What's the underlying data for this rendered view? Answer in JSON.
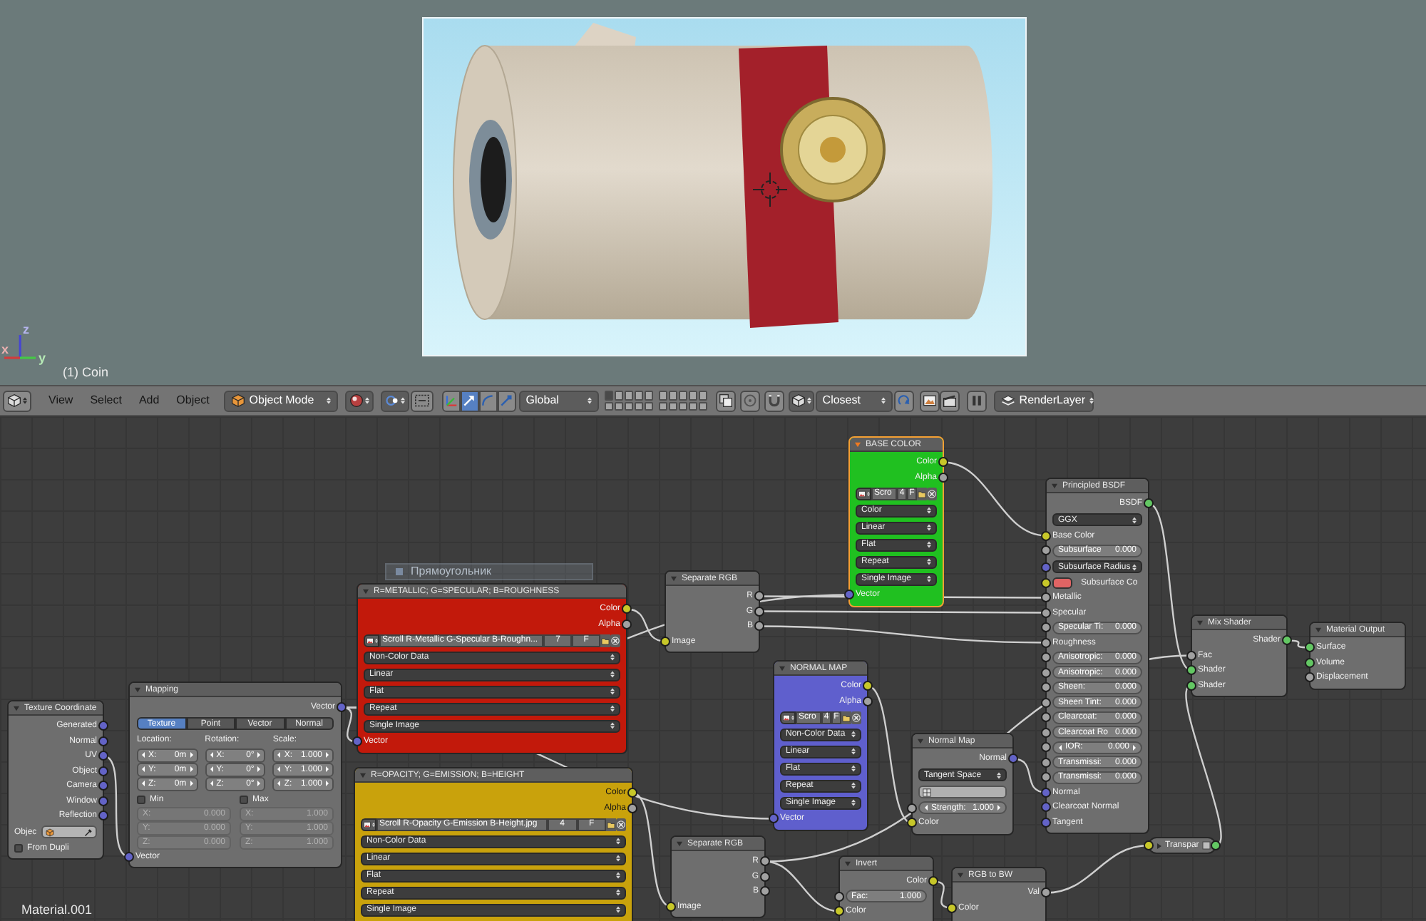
{
  "viewport": {
    "axes": [
      {
        "label": "z",
        "color": "#4646d2"
      },
      {
        "label": "x",
        "color": "#d23c3c"
      },
      {
        "label": "y",
        "color": "#46c846"
      }
    ],
    "object_label": "(1) Coin"
  },
  "header": {
    "menus": [
      "View",
      "Select",
      "Add",
      "Object"
    ],
    "mode": "Object Mode",
    "manipulators": [
      {
        "kind": "axes",
        "selected": false
      },
      {
        "kind": "translate",
        "selected": true
      },
      {
        "kind": "rotate",
        "selected": false
      },
      {
        "kind": "scale",
        "selected": false
      }
    ],
    "orientation": "Global",
    "layers": [
      {
        "selected": true
      },
      {
        "selected": false
      },
      {
        "selected": false
      },
      {
        "selected": false
      },
      {
        "selected": false
      },
      {
        "selected": false
      },
      {
        "selected": false
      },
      {
        "selected": false
      },
      {
        "selected": false
      },
      {
        "selected": false
      },
      {
        "selected": false
      },
      {
        "selected": false
      },
      {
        "selected": false
      },
      {
        "selected": false
      },
      {
        "selected": false
      },
      {
        "selected": false
      },
      {
        "selected": false
      },
      {
        "selected": false
      },
      {
        "selected": false
      },
      {
        "selected": false
      }
    ],
    "snap_target": "Closest",
    "render_layer": "RenderLayer"
  },
  "overlay_label": "Прямоугольник",
  "nodes": [
    {
      "title": "Texture Coordinate",
      "collapsed": false,
      "selected": false,
      "rows": [
        {
          "kind": "output",
          "label": "Generated",
          "socket": {
            "kind": "vector"
          }
        },
        {
          "kind": "output",
          "label": "Normal",
          "socket": {
            "kind": "vector"
          }
        },
        {
          "kind": "output",
          "label": "UV",
          "socket": {
            "kind": "vector"
          }
        },
        {
          "kind": "output",
          "label": "Object",
          "socket": {
            "kind": "vector"
          }
        },
        {
          "kind": "output",
          "label": "Camera",
          "socket": {
            "kind": "vector"
          }
        },
        {
          "kind": "output",
          "label": "Window",
          "socket": {
            "kind": "vector"
          }
        },
        {
          "kind": "output",
          "label": "Reflection",
          "socket": {
            "kind": "vector"
          }
        },
        {
          "kind": "object_field",
          "label": "Objec"
        },
        {
          "kind": "checkbox",
          "label": "From Dupli",
          "checked": false
        }
      ]
    },
    {
      "title": "Mapping",
      "collapsed": false,
      "selected": false,
      "rows": [
        {
          "kind": "output",
          "label": "Vector",
          "socket": {
            "kind": "vector"
          }
        },
        {
          "kind": "tabs",
          "items": [
            {
              "label": "Texture",
              "selected": true
            },
            {
              "label": "Point",
              "selected": false
            },
            {
              "label": "Vector",
              "selected": false
            },
            {
              "label": "Normal",
              "selected": false
            }
          ]
        },
        {
          "kind": "vector_columns",
          "columns": [
            {
              "label": "Location:",
              "fields": [
                {
                  "label": "X:",
                  "value": "0m"
                },
                {
                  "label": "Y:",
                  "value": "0m"
                },
                {
                  "label": "Z:",
                  "value": "0m"
                }
              ]
            },
            {
              "label": "Rotation:",
              "fields": [
                {
                  "label": "X:",
                  "value": "0°"
                },
                {
                  "label": "Y:",
                  "value": "0°"
                },
                {
                  "label": "Z:",
                  "value": "0°"
                }
              ]
            },
            {
              "label": "Scale:",
              "fields": [
                {
                  "label": "X:",
                  "value": "1.000"
                },
                {
                  "label": "Y:",
                  "value": "1.000"
                },
                {
                  "label": "Z:",
                  "value": "1.000"
                }
              ]
            }
          ]
        },
        {
          "kind": "limit_columns",
          "columns": [
            {
              "label": "Min",
              "checked": false,
              "fields": [
                {
                  "label": "X:",
                  "value": "0.000"
                },
                {
                  "label": "Y:",
                  "value": "0.000"
                },
                {
                  "label": "Z:",
                  "value": "0.000"
                }
              ]
            },
            {
              "label": "Max",
              "checked": false,
              "fields": [
                {
                  "label": "X:",
                  "value": "1.000"
                },
                {
                  "label": "Y:",
                  "value": "1.000"
                },
                {
                  "label": "Z:",
                  "value": "1.000"
                }
              ]
            }
          ]
        },
        {
          "kind": "input",
          "label": "Vector",
          "socket": {
            "kind": "vector"
          }
        }
      ]
    },
    {
      "title": "R=METALLIC; G=SPECULAR; B=ROUGHNESS",
      "color": "#c2190b",
      "collapsed": false,
      "selected": false,
      "rows": [
        {
          "kind": "output",
          "label": "Color",
          "socket": {
            "kind": "color"
          }
        },
        {
          "kind": "output",
          "label": "Alpha",
          "socket": {
            "kind": "value"
          }
        },
        {
          "kind": "image",
          "name": "Scroll R-Metallic G-Specular B-Roughn...",
          "users": "7",
          "fake_user": "F"
        },
        {
          "kind": "dropdown",
          "value": "Non-Color Data"
        },
        {
          "kind": "dropdown",
          "value": "Linear"
        },
        {
          "kind": "dropdown",
          "value": "Flat"
        },
        {
          "kind": "dropdown",
          "value": "Repeat"
        },
        {
          "kind": "dropdown",
          "value": "Single Image"
        },
        {
          "kind": "input",
          "label": "Vector",
          "socket": {
            "kind": "vector"
          }
        }
      ]
    },
    {
      "title": "R=OPACITY; G=EMISSION; B=HEIGHT",
      "color": "#c9a20c",
      "collapsed": false,
      "selected": false,
      "rows": [
        {
          "kind": "output",
          "label": "Color",
          "socket": {
            "kind": "color"
          }
        },
        {
          "kind": "output",
          "label": "Alpha",
          "socket": {
            "kind": "value"
          }
        },
        {
          "kind": "image",
          "name": "Scroll R-Opacity G-Emission B-Height.jpg",
          "users": "4",
          "fake_user": "F"
        },
        {
          "kind": "dropdown",
          "value": "Non-Color Data"
        },
        {
          "kind": "dropdown",
          "value": "Linear"
        },
        {
          "kind": "dropdown",
          "value": "Flat"
        },
        {
          "kind": "dropdown",
          "value": "Repeat"
        },
        {
          "kind": "dropdown",
          "value": "Single Image"
        }
      ]
    },
    {
      "title": "Separate RGB",
      "collapsed": false,
      "selected": false,
      "rows": [
        {
          "kind": "output",
          "label": "R",
          "socket": {
            "kind": "value"
          }
        },
        {
          "kind": "output",
          "label": "G",
          "socket": {
            "kind": "value"
          }
        },
        {
          "kind": "output",
          "label": "B",
          "socket": {
            "kind": "value"
          }
        },
        {
          "kind": "input",
          "label": "Image",
          "socket": {
            "kind": "color"
          }
        }
      ]
    },
    {
      "title": "BASE COLOR",
      "color": "#20c020",
      "collapsed": false,
      "selected": true,
      "rows": [
        {
          "kind": "output",
          "label": "Color",
          "socket": {
            "kind": "color"
          }
        },
        {
          "kind": "output",
          "label": "Alpha",
          "socket": {
            "kind": "value"
          }
        },
        {
          "kind": "image",
          "name": "Scro",
          "users": "4",
          "fake_user": "F"
        },
        {
          "kind": "dropdown",
          "value": "Color"
        },
        {
          "kind": "dropdown",
          "value": "Linear"
        },
        {
          "kind": "dropdown",
          "value": "Flat"
        },
        {
          "kind": "dropdown",
          "value": "Repeat"
        },
        {
          "kind": "dropdown",
          "value": "Single Image"
        },
        {
          "kind": "input",
          "label": "Vector",
          "socket": {
            "kind": "vector"
          }
        }
      ]
    },
    {
      "title": "NORMAL MAP",
      "color": "#5f5fcd",
      "collapsed": false,
      "selected": false,
      "rows": [
        {
          "kind": "output",
          "label": "Color",
          "socket": {
            "kind": "color"
          }
        },
        {
          "kind": "output",
          "label": "Alpha",
          "socket": {
            "kind": "value"
          }
        },
        {
          "kind": "image",
          "name": "Scro",
          "users": "4",
          "fake_user": "F"
        },
        {
          "kind": "dropdown",
          "value": "Non-Color Data"
        },
        {
          "kind": "dropdown",
          "value": "Linear"
        },
        {
          "kind": "dropdown",
          "value": "Flat"
        },
        {
          "kind": "dropdown",
          "value": "Repeat"
        },
        {
          "kind": "dropdown",
          "value": "Single Image"
        },
        {
          "kind": "input",
          "label": "Vector",
          "socket": {
            "kind": "vector"
          }
        }
      ]
    },
    {
      "title": "Normal Map",
      "collapsed": false,
      "selected": false,
      "rows": [
        {
          "kind": "output",
          "label": "Normal",
          "socket": {
            "kind": "vector"
          }
        },
        {
          "kind": "dropdown",
          "value": "Tangent Space"
        },
        {
          "kind": "search_field"
        },
        {
          "kind": "number",
          "label": "Strength:",
          "value": "1.000",
          "socket": {
            "kind": "value"
          }
        },
        {
          "kind": "input",
          "label": "Color",
          "socket": {
            "kind": "color"
          }
        }
      ]
    },
    {
      "title": "Separate RGB",
      "collapsed": false,
      "selected": false,
      "rows": [
        {
          "kind": "output",
          "label": "R",
          "socket": {
            "kind": "value"
          }
        },
        {
          "kind": "output",
          "label": "G",
          "socket": {
            "kind": "value"
          }
        },
        {
          "kind": "output",
          "label": "B",
          "socket": {
            "kind": "value"
          }
        },
        {
          "kind": "input",
          "label": "Image",
          "socket": {
            "kind": "color"
          }
        }
      ]
    },
    {
      "title": "Invert",
      "collapsed": false,
      "selected": false,
      "rows": [
        {
          "kind": "output",
          "label": "Color",
          "socket": {
            "kind": "color"
          }
        },
        {
          "kind": "slider",
          "label": "Fac:",
          "value": "1.000",
          "socket": {
            "kind": "value"
          }
        },
        {
          "kind": "input",
          "label": "Color",
          "socket": {
            "kind": "color"
          }
        }
      ]
    },
    {
      "title": "RGB to BW",
      "collapsed": false,
      "selected": false,
      "rows": [
        {
          "kind": "output",
          "label": "Val",
          "socket": {
            "kind": "value"
          }
        },
        {
          "kind": "input",
          "label": "Color",
          "socket": {
            "kind": "color"
          }
        }
      ]
    },
    {
      "title": "Principled BSDF",
      "collapsed": false,
      "selected": false,
      "rows": [
        {
          "kind": "output",
          "label": "BSDF",
          "socket": {
            "kind": "shader"
          }
        },
        {
          "kind": "dropdown",
          "value": "GGX"
        },
        {
          "kind": "input",
          "label": "Base Color",
          "socket": {
            "kind": "color"
          }
        },
        {
          "kind": "slider",
          "label": "Subsurface",
          "value": "0.000",
          "socket": {
            "kind": "value"
          }
        },
        {
          "kind": "dropdown",
          "value": "Subsurface Radius",
          "socket": {
            "kind": "vector"
          }
        },
        {
          "kind": "color_input",
          "label": "Subsurface Co",
          "color": "#e06464",
          "socket": {
            "kind": "color"
          }
        },
        {
          "kind": "input",
          "label": "Metallic",
          "socket": {
            "kind": "value"
          }
        },
        {
          "kind": "input",
          "label": "Specular",
          "socket": {
            "kind": "value"
          }
        },
        {
          "kind": "slider",
          "label": "Specular Ti:",
          "value": "0.000",
          "socket": {
            "kind": "value"
          }
        },
        {
          "kind": "input",
          "label": "Roughness",
          "socket": {
            "kind": "value"
          }
        },
        {
          "kind": "slider",
          "label": "Anisotropic:",
          "value": "0.000",
          "socket": {
            "kind": "value"
          }
        },
        {
          "kind": "slider",
          "label": "Anisotropic:",
          "value": "0.000",
          "socket": {
            "kind": "value"
          }
        },
        {
          "kind": "slider",
          "label": "Sheen:",
          "value": "0.000",
          "socket": {
            "kind": "value"
          }
        },
        {
          "kind": "slider",
          "label": "Sheen Tint:",
          "value": "0.000",
          "socket": {
            "kind": "value"
          }
        },
        {
          "kind": "slider",
          "label": "Clearcoat:",
          "value": "0.000",
          "socket": {
            "kind": "value"
          }
        },
        {
          "kind": "slider",
          "label": "Clearcoat Ro",
          "value": "0.000",
          "socket": {
            "kind": "value"
          }
        },
        {
          "kind": "number",
          "label": "IOR:",
          "value": "0.000",
          "socket": {
            "kind": "value"
          }
        },
        {
          "kind": "slider",
          "label": "Transmissi:",
          "value": "0.000",
          "socket": {
            "kind": "value"
          }
        },
        {
          "kind": "slider",
          "label": "Transmissi:",
          "value": "0.000",
          "socket": {
            "kind": "value"
          }
        },
        {
          "kind": "input",
          "label": "Normal",
          "socket": {
            "kind": "vector"
          }
        },
        {
          "kind": "input",
          "label": "Clearcoat Normal",
          "socket": {
            "kind": "vector"
          }
        },
        {
          "kind": "input",
          "label": "Tangent",
          "socket": {
            "kind": "vector"
          }
        }
      ]
    },
    {
      "title": "Mix Shader",
      "collapsed": false,
      "selected": false,
      "rows": [
        {
          "kind": "output",
          "label": "Shader",
          "socket": {
            "kind": "shader"
          }
        },
        {
          "kind": "input",
          "label": "Fac",
          "socket": {
            "kind": "value"
          }
        },
        {
          "kind": "input",
          "label": "Shader",
          "socket": {
            "kind": "shader"
          }
        },
        {
          "kind": "input",
          "label": "Shader",
          "socket": {
            "kind": "shader"
          }
        }
      ]
    },
    {
      "title": "Material Output",
      "collapsed": false,
      "selected": false,
      "rows": [
        {
          "kind": "input",
          "label": "Surface",
          "socket": {
            "kind": "shader"
          }
        },
        {
          "kind": "input",
          "label": "Volume",
          "socket": {
            "kind": "shader"
          }
        },
        {
          "kind": "input",
          "label": "Displacement",
          "socket": {
            "kind": "value"
          }
        }
      ]
    },
    {
      "title": "Transpar",
      "collapsed": true,
      "selected": false,
      "rows": [
        {
          "kind": "input",
          "socket": {
            "kind": "color"
          }
        },
        {
          "kind": "output",
          "socket": {
            "kind": "shader"
          }
        }
      ]
    }
  ],
  "material_label": "Material.001"
}
